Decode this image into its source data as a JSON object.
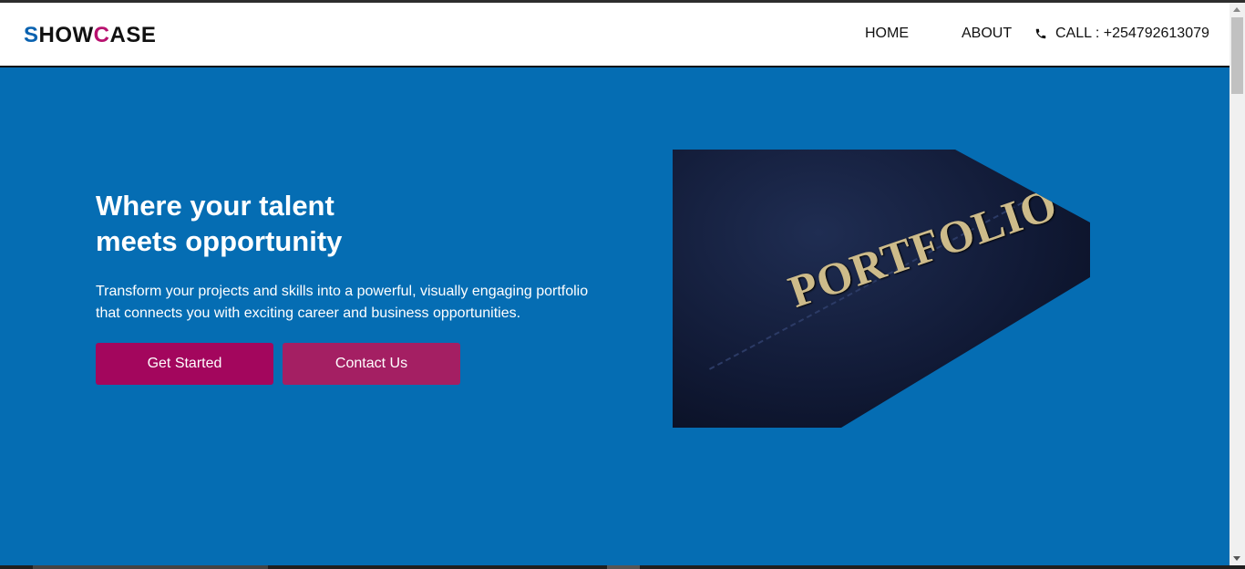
{
  "header": {
    "logo": {
      "s": "S",
      "how": "HOW",
      "c": "C",
      "ase": "ASE"
    },
    "nav": {
      "home": "HOME",
      "about": "ABOUT",
      "call": "CALL : +254792613079"
    }
  },
  "hero": {
    "title_line1": "Where your talent",
    "title_line2": "meets opportunity",
    "text": "Transform your projects and skills into a powerful, visually engaging portfolio that connects you with exciting career and business opportunities.",
    "buttons": {
      "get_started": "Get Started",
      "contact": "Contact Us"
    },
    "image_text": "PORTFOLIO"
  },
  "colors": {
    "hero_background": "#056db3",
    "logo_blue": "#0a62b0",
    "logo_pink": "#b8126f",
    "button_primary": "#a3065d",
    "button_secondary": "#a41f63"
  },
  "icons": {
    "call": "phone-icon"
  }
}
